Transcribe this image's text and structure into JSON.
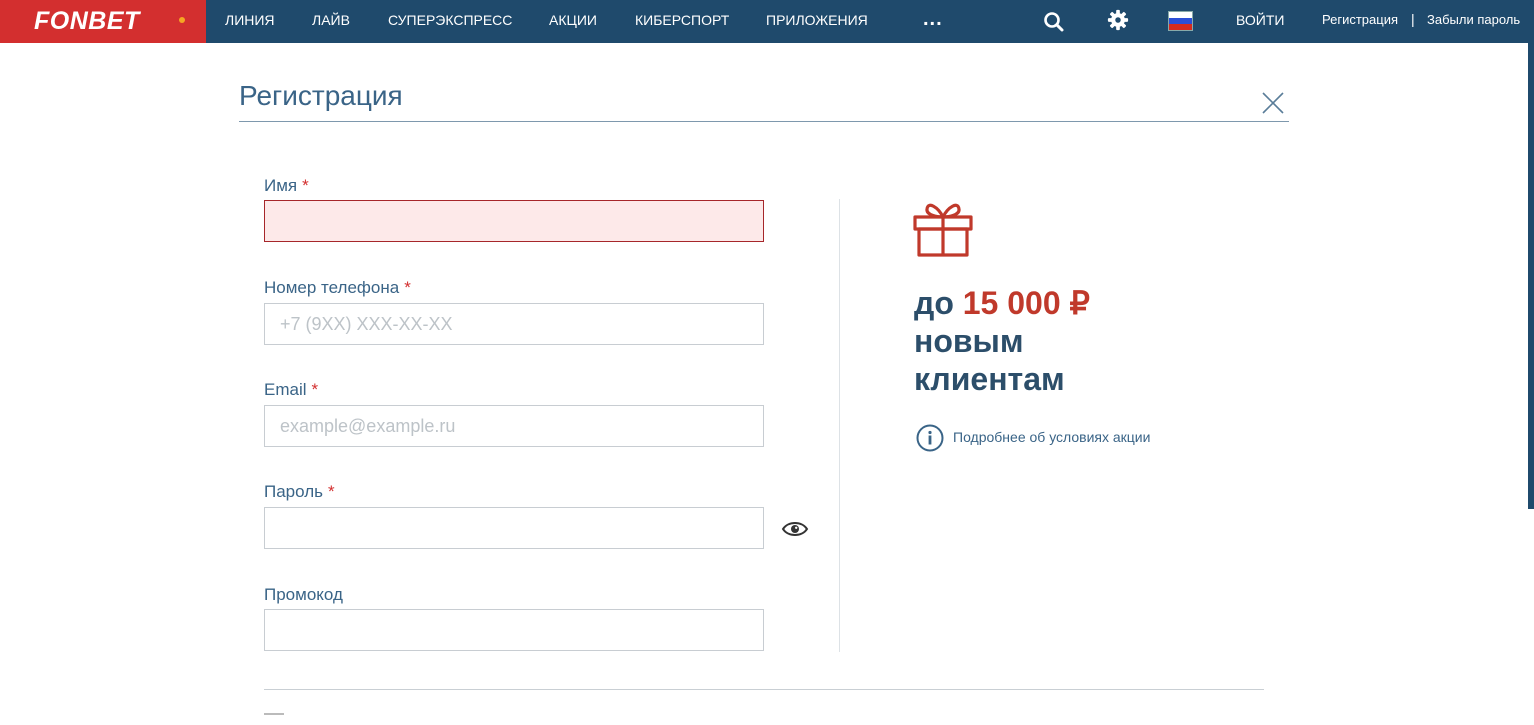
{
  "header": {
    "logo_text": "FONBET",
    "nav": [
      "ЛИНИЯ",
      "ЛАЙВ",
      "СУПЕРЭКСПРЕСС",
      "АКЦИИ",
      "КИБЕРСПОРТ",
      "ПРИЛОЖЕНИЯ"
    ],
    "more": "...",
    "login": "ВОЙТИ",
    "register": "Регистрация",
    "separator": "|",
    "forgot_password": "Забыли пароль",
    "icons": [
      "search-icon",
      "gear-icon",
      "russia-flag-icon"
    ]
  },
  "modal": {
    "title": "Регистрация"
  },
  "form": {
    "required_mark": "*",
    "name": {
      "label": "Имя",
      "value": "",
      "placeholder": ""
    },
    "phone": {
      "label": "Номер телефона",
      "value": "",
      "placeholder": "+7 (9XX) XXX-XX-XX"
    },
    "email": {
      "label": "Email",
      "value": "",
      "placeholder": "example@example.ru"
    },
    "password": {
      "label": "Пароль",
      "value": "",
      "placeholder": ""
    },
    "promo": {
      "label": "Промокод",
      "value": "",
      "placeholder": ""
    }
  },
  "promo": {
    "prefix": "до",
    "amount": "15 000 ₽",
    "line2": "новым",
    "line3": "клиентам",
    "details_link": "Подробнее об условиях акции"
  },
  "colors": {
    "header_bg": "#1f4a6c",
    "logo_bg": "#d32f2f",
    "accent_red": "#c0392b",
    "error_field_bg": "#fde9e9",
    "text_blue": "#3a6487"
  }
}
